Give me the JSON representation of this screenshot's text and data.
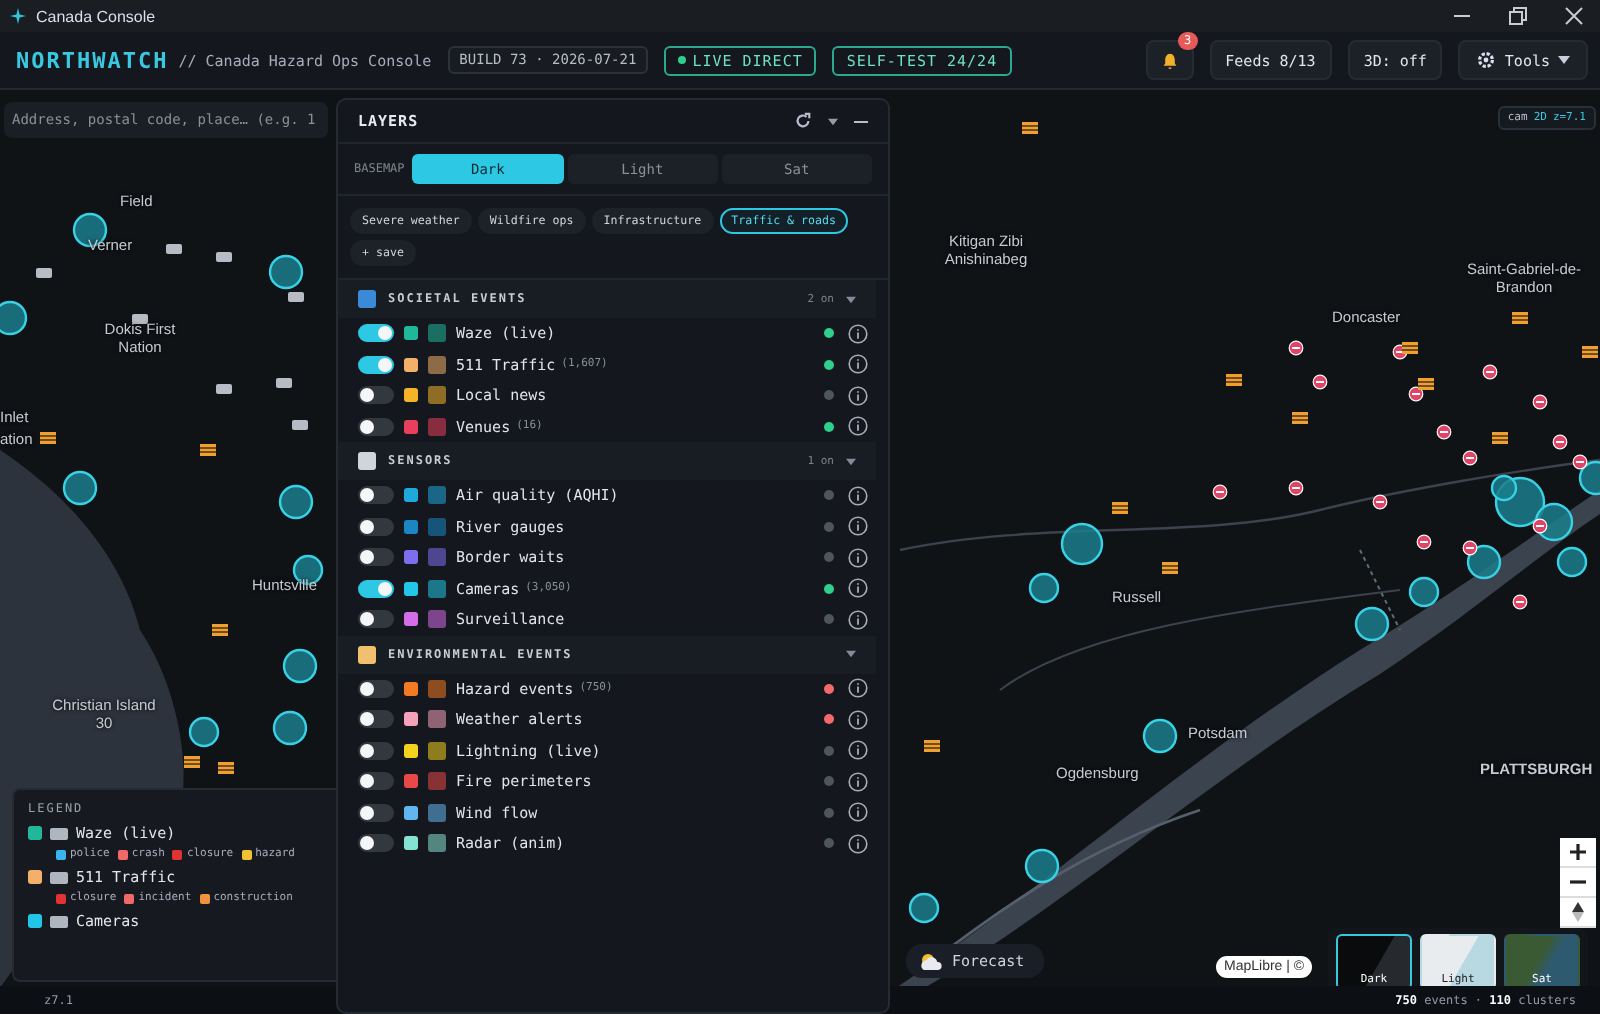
{
  "window": {
    "title": "Canada Console"
  },
  "header": {
    "brand": "NORTHWATCH",
    "subtitle": "// Canada Hazard Ops Console",
    "build": "BUILD 73 · 2026-07-21",
    "live": {
      "label": "LIVE DIRECT",
      "on": true
    },
    "selftest": "SELF-TEST 24/24",
    "notifications": "3",
    "feeds": "Feeds 8/13",
    "view3d": "3D: off",
    "tools": "Tools"
  },
  "search": {
    "placeholder": "Address, postal code, place… (e.g. 1"
  },
  "layers_panel": {
    "title": "LAYERS",
    "basemap_label": "BASEMAP",
    "basemaps": [
      {
        "label": "Dark",
        "selected": true
      },
      {
        "label": "Light",
        "selected": false
      },
      {
        "label": "Sat",
        "selected": false
      }
    ],
    "presets": [
      {
        "label": "Severe weather",
        "selected": false
      },
      {
        "label": "Wildfire ops",
        "selected": false
      },
      {
        "label": "Infrastructure",
        "selected": false
      },
      {
        "label": "Traffic & roads",
        "selected": true
      }
    ],
    "save": "+ save",
    "sections": [
      {
        "title": "SOCIETAL EVENTS",
        "count": "2 on",
        "expanded": true,
        "layers": [
          {
            "name": "Waze (live)",
            "on": true,
            "color": "#1fb89b",
            "status": {
              "color": "#2fcf8e"
            }
          },
          {
            "name": "511 Traffic",
            "count": "(1,607)",
            "on": true,
            "color": "#f2b06a",
            "status": {
              "color": "#2fcf8e"
            }
          },
          {
            "name": "Local news",
            "on": false,
            "color": "#f4b42a",
            "status": {
              "color": "#4f555e"
            }
          },
          {
            "name": "Venues",
            "count": "(16)",
            "on": false,
            "color": "#e8405c",
            "status": {
              "color": "#2fcf8e"
            }
          }
        ]
      },
      {
        "title": "SENSORS",
        "count": "1 on",
        "expanded": true,
        "layers": [
          {
            "name": "Air quality (AQHI)",
            "on": false,
            "color": "#1fa8dc",
            "status": {
              "color": "#4f555e"
            }
          },
          {
            "name": "River gauges",
            "on": false,
            "color": "#1a86c4",
            "status": {
              "color": "#4f555e"
            }
          },
          {
            "name": "Border waits",
            "on": false,
            "color": "#7d6ef0",
            "status": {
              "color": "#4f555e"
            }
          },
          {
            "name": "Cameras",
            "count": "(3,050)",
            "on": true,
            "color": "#22c6e6",
            "status": {
              "color": "#2fcf8e"
            }
          },
          {
            "name": "Surveillance",
            "on": false,
            "color": "#d46ee8",
            "status": {
              "color": "#4f555e"
            }
          }
        ]
      },
      {
        "title": "ENVIRONMENTAL EVENTS",
        "expanded": true,
        "layers": [
          {
            "name": "Hazard events",
            "count": "(750)",
            "on": false,
            "color": "#f27a24",
            "status": {
              "color": "#f26a6a"
            }
          },
          {
            "name": "Weather alerts",
            "on": false,
            "color": "#f4a2bc",
            "status": {
              "color": "#f26a6a"
            }
          },
          {
            "name": "Lightning (live)",
            "on": false,
            "color": "#f4d21e",
            "status": {
              "color": "#4f555e"
            }
          },
          {
            "name": "Fire perimeters",
            "on": false,
            "color": "#e84848",
            "status": {
              "color": "#4f555e"
            }
          },
          {
            "name": "Wind flow",
            "on": false,
            "color": "#62b6f0",
            "status": {
              "color": "#4f555e"
            }
          },
          {
            "name": "Radar (anim)",
            "on": false,
            "color": "#86e2d2",
            "status": {
              "color": "#4f555e"
            }
          }
        ]
      }
    ]
  },
  "map": {
    "camera": {
      "mode": "cam",
      "dim": "2D",
      "zoom": "z=7.1"
    },
    "labels": [
      "Field",
      "Verner",
      "Dokis First Nation",
      "Inlet",
      "ation",
      "Huntsville",
      "Christian Island 30",
      "Kitigan Zibi Anishinabeg",
      "Doncaster",
      "Saint-Gabriel-de-Brandon",
      "Russell",
      "Ogdensburg",
      "Potsdam",
      "PLATTSBURGH"
    ],
    "forecast": "Forecast",
    "attribution": "MapLibre | ©",
    "basemap_thumbs": [
      {
        "label": "Dark",
        "selected": true
      },
      {
        "label": "Light",
        "selected": false
      },
      {
        "label": "Sat",
        "selected": false
      }
    ]
  },
  "legend": {
    "title": "LEGEND",
    "groups": [
      {
        "name": "Waze (live)",
        "color": "#1fb89b",
        "items": [
          {
            "label": "police",
            "color": "#3ab4f0"
          },
          {
            "label": "crash",
            "color": "#f06868"
          },
          {
            "label": "closure",
            "color": "#e03434"
          },
          {
            "label": "hazard",
            "color": "#f0c232"
          }
        ]
      },
      {
        "name": "511 Traffic",
        "color": "#f2b06a",
        "items": [
          {
            "label": "closure",
            "color": "#e03434"
          },
          {
            "label": "incident",
            "color": "#f06868"
          },
          {
            "label": "construction",
            "color": "#f0923c"
          }
        ]
      },
      {
        "name": "Cameras",
        "color": "#22c6e6"
      }
    ]
  },
  "status_bar": {
    "zoom": "z7.1",
    "summary": "**750** events · **110** clusters"
  }
}
